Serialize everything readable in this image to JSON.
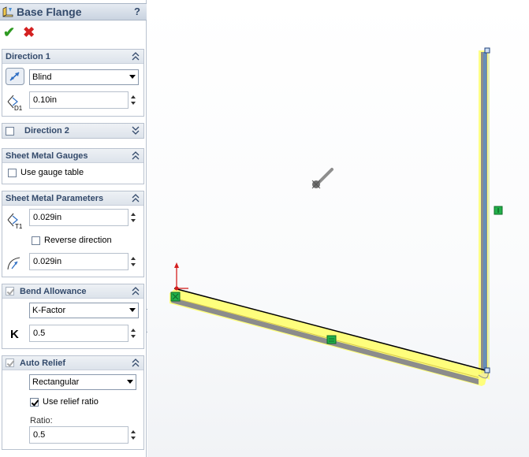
{
  "window": {
    "title": "Base Flange",
    "help": "?"
  },
  "actions": {
    "ok": "✔",
    "cancel": "✖"
  },
  "direction1": {
    "header": "Direction 1",
    "end_condition": "Blind",
    "depth_prefix": "D1",
    "depth": "0.10in"
  },
  "direction2": {
    "header": "Direction 2"
  },
  "gauges": {
    "header": "Sheet Metal Gauges",
    "use_gauge_table": "Use gauge table"
  },
  "parameters": {
    "header": "Sheet Metal Parameters",
    "thickness_prefix": "T1",
    "thickness": "0.029in",
    "reverse_direction": "Reverse direction",
    "bend_radius": "0.029in"
  },
  "bend_allowance": {
    "header": "Bend Allowance",
    "type": "K-Factor",
    "k_label": "K",
    "k_value": "0.5"
  },
  "auto_relief": {
    "header": "Auto Relief",
    "type": "Rectangular",
    "use_relief_ratio": "Use relief ratio",
    "ratio_label": "Ratio:",
    "ratio": "0.5"
  },
  "colors": {
    "accent": "#334a6b",
    "flange_highlight": "#ffff66",
    "flange_body": "#8c8c8c",
    "sketch_line": "#4a8fd6",
    "relation_marker": "#22b04a"
  },
  "icons": [
    "base-flange-icon",
    "check-icon",
    "cross-icon",
    "direction-flip-icon",
    "depth-icon",
    "thickness-icon",
    "bend-radius-icon",
    "k-factor-icon",
    "chevron-up-icon",
    "chevron-down-icon",
    "origin-triad-icon",
    "view-cursor-icon"
  ]
}
